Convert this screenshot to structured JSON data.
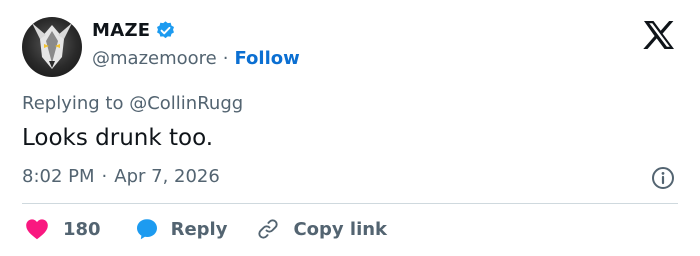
{
  "author": {
    "name": "MAZE",
    "handle": "@mazemoore",
    "separator": "·",
    "follow_label": "Follow",
    "avatar_icon": "wolf-avatar-icon",
    "verified_color": "#1d9bf0"
  },
  "tweet": {
    "reply_prefix": "Replying to",
    "reply_to": "@CollinRugg",
    "text": "Looks drunk too.",
    "time": "8:02 PM",
    "separator": "·",
    "date": "Apr 7, 2026"
  },
  "actions": {
    "like_count": "180",
    "reply_label": "Reply",
    "copy_label": "Copy link",
    "like_color": "#f91880",
    "reply_color": "#1d9bf0"
  },
  "icons": {
    "brand": "x-logo-icon",
    "info": "info-icon",
    "like": "heart-icon",
    "reply": "speech-bubble-icon",
    "copy": "link-icon"
  }
}
